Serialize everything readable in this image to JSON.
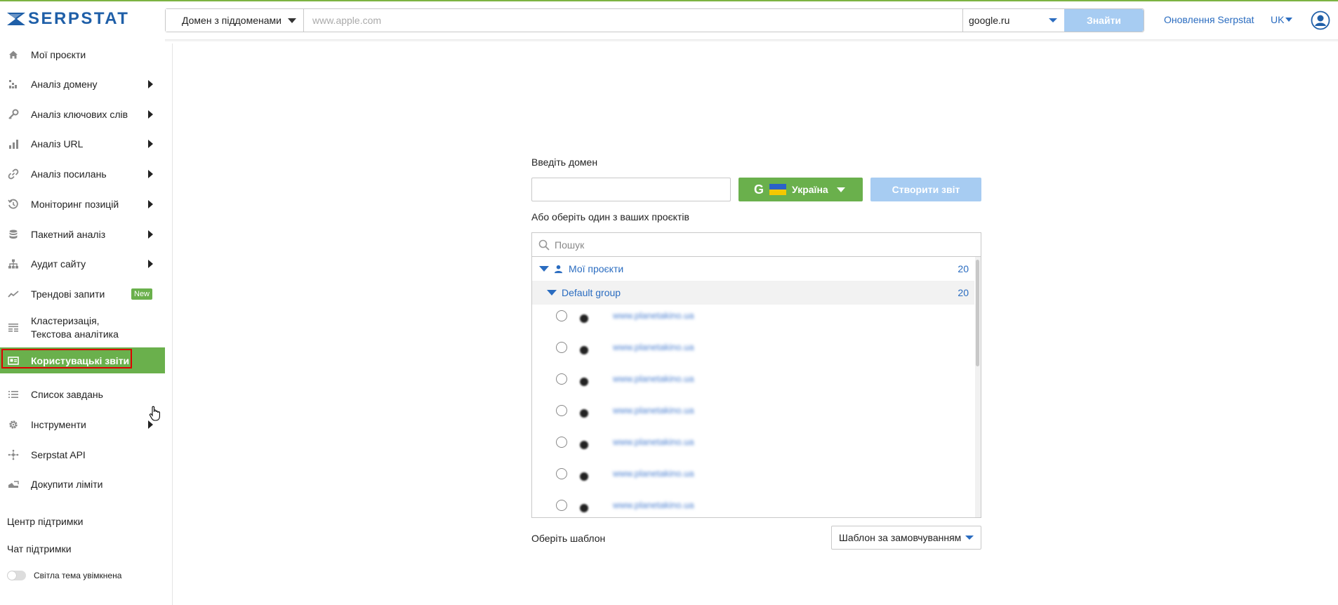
{
  "brand": {
    "name": "SERPSTAT",
    "color": "#1f5fa8",
    "accent": "#6ab04c"
  },
  "topbar": {
    "scope_label": "Домен з піддоменами",
    "search_placeholder": "www.apple.com",
    "search_value": "",
    "engine_label": "google.ru",
    "find_label": "Знайти",
    "updates_link": "Оновлення Serpstat",
    "lang": "UK"
  },
  "sidebar": {
    "items": [
      {
        "label": "Мої проєкти",
        "icon": "home-icon",
        "submenu": false
      },
      {
        "label": "Аналіз домену",
        "icon": "domain-analysis-icon",
        "submenu": true
      },
      {
        "label": "Аналіз ключових слів",
        "icon": "key-icon",
        "submenu": true
      },
      {
        "label": "Аналіз URL",
        "icon": "bar-chart-icon",
        "submenu": true
      },
      {
        "label": "Аналіз посилань",
        "icon": "link-icon",
        "submenu": true
      },
      {
        "label": "Моніторинг позицій",
        "icon": "history-icon",
        "submenu": true
      },
      {
        "label": "Пакетний аналіз",
        "icon": "database-icon",
        "submenu": true
      },
      {
        "label": "Аудит сайту",
        "icon": "sitemap-icon",
        "submenu": true
      },
      {
        "label": "Трендові запити",
        "icon": "trend-icon",
        "submenu": false,
        "badge": "New"
      },
      {
        "label_line1": "Кластеризація,",
        "label_line2": "Текстова аналітика",
        "icon": "clustering-icon",
        "submenu": false
      },
      {
        "label": "Користувацькі звіти",
        "icon": "report-icon",
        "submenu": false,
        "active": true
      },
      {
        "label": "Список завдань",
        "icon": "list-icon",
        "submenu": false
      },
      {
        "label": "Інструменти",
        "icon": "gear-icon",
        "submenu": true
      },
      {
        "label": "Serpstat API",
        "icon": "api-icon",
        "submenu": false
      },
      {
        "label": "Докупити ліміти",
        "icon": "limits-icon",
        "submenu": false
      }
    ],
    "support_center": "Центр підтримки",
    "support_chat": "Чат підтримки",
    "theme_toggle": "Світла тема увімкнена"
  },
  "form": {
    "domain_label": "Введіть домен",
    "domain_value": "",
    "region_label": "Україна",
    "create_label": "Створити звіт",
    "or_label": "Або оберіть один з ваших проєктів",
    "search_placeholder": "Пошук",
    "tree": {
      "root_label": "Мої проєкти",
      "root_count": "20",
      "group_label": "Default group",
      "group_count": "20"
    },
    "projects": [
      "www.planetakino.ua",
      "www.planetakino.ua",
      "www.planetakino.ua",
      "www.planetakino.ua",
      "www.planetakino.ua",
      "www.planetakino.ua",
      "www.planetakino.ua"
    ],
    "template_label": "Оберіть шаблон",
    "template_value": "Шаблон за замовчуванням"
  }
}
